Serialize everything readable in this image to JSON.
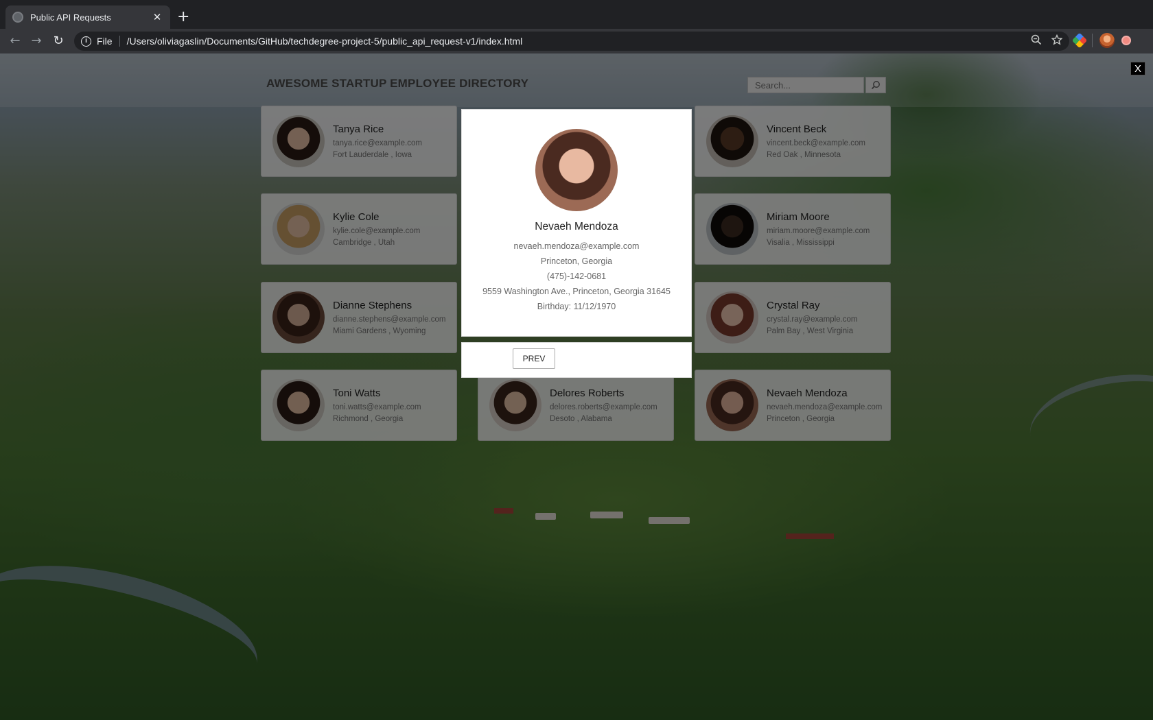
{
  "browser": {
    "tab_title": "Public API Requests",
    "tab_close": "✕",
    "new_tab": "+",
    "scheme_label": "File",
    "url": "/Users/oliviagaslin/Documents/GitHub/techdegree-project-5/public_api_request-v1/index.html"
  },
  "page": {
    "title": "AWESOME STARTUP EMPLOYEE DIRECTORY",
    "search_placeholder": "Search..."
  },
  "employees": [
    {
      "name": "Tanya Rice",
      "email": "tanya.rice@example.com",
      "location": "Fort Lauderdale , Iowa"
    },
    {
      "name": "Vincent Beck",
      "email": "vincent.beck@example.com",
      "location": "Red Oak , Minnesota"
    },
    {
      "name": "Kylie Cole",
      "email": "kylie.cole@example.com",
      "location": "Cambridge , Utah"
    },
    {
      "name": "Miriam Moore",
      "email": "miriam.moore@example.com",
      "location": "Visalia , Mississippi"
    },
    {
      "name": "Dianne Stephens",
      "email": "dianne.stephens@example.com",
      "location": "Miami Gardens , Wyoming"
    },
    {
      "name": "Crystal Ray",
      "email": "crystal.ray@example.com",
      "location": "Palm Bay , West Virginia"
    },
    {
      "name": "Toni Watts",
      "email": "toni.watts@example.com",
      "location": "Richmond , Georgia"
    },
    {
      "name": "Delores Roberts",
      "email": "delores.roberts@example.com",
      "location": "Desoto , Alabama"
    },
    {
      "name": "Nevaeh Mendoza",
      "email": "nevaeh.mendoza@example.com",
      "location": "Princeton , Georgia"
    }
  ],
  "modal": {
    "name": "Nevaeh Mendoza",
    "email": "nevaeh.mendoza@example.com",
    "city": "Princeton, Georgia",
    "phone": "(475)-142-0681",
    "address": "9559 Washington Ave., Princeton, Georgia 31645",
    "birthday": "Birthday: 11/12/1970",
    "prev_label": "PREV",
    "close_label": "X"
  }
}
